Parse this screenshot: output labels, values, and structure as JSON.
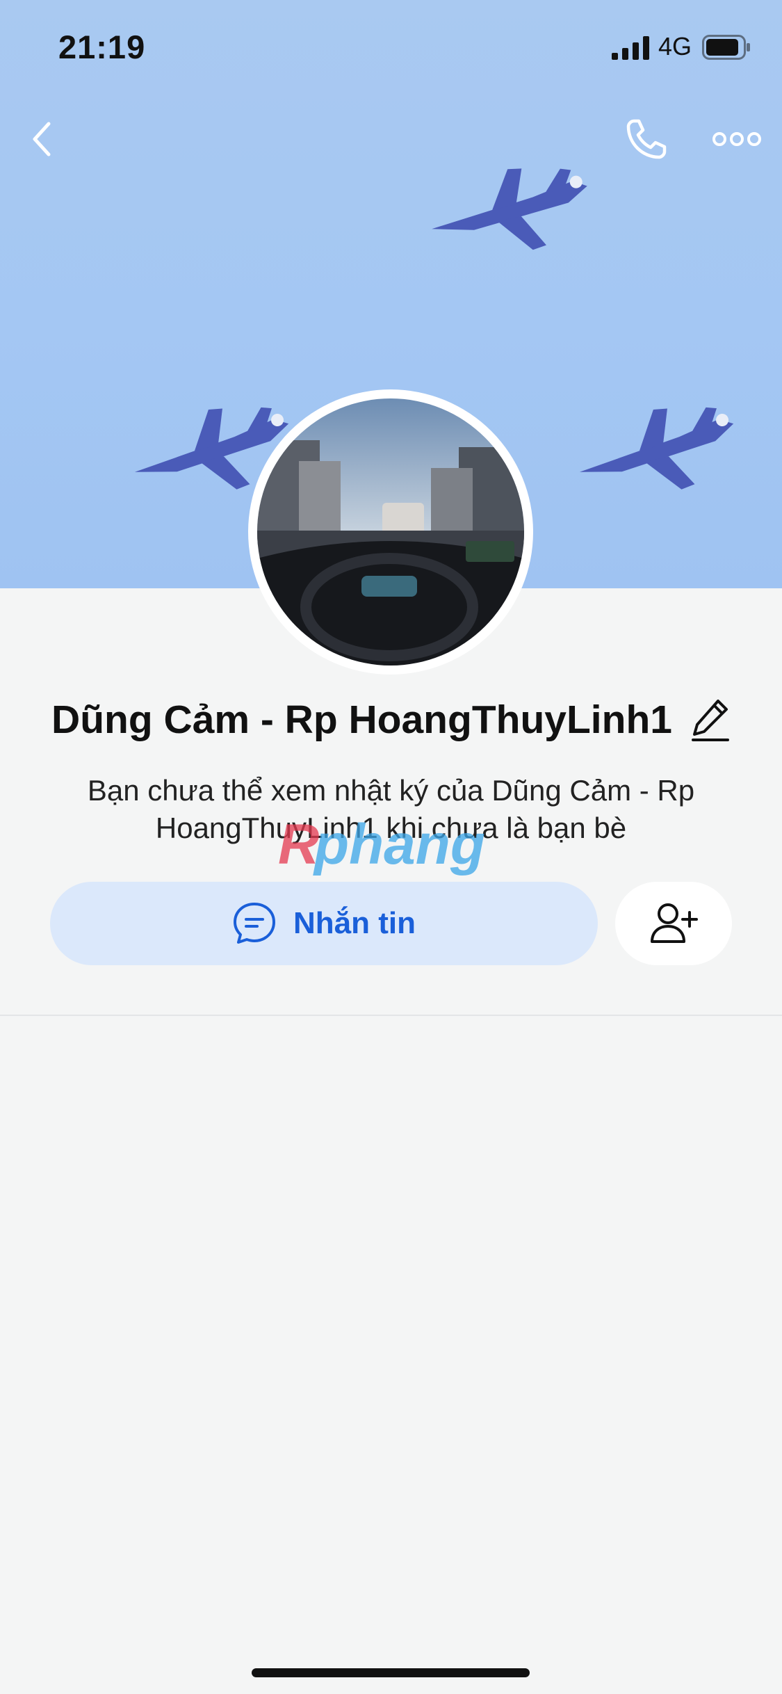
{
  "status_bar": {
    "time": "21:19",
    "network": "4G"
  },
  "header": {
    "back_icon": "chevron-left-icon",
    "call_icon": "phone-icon",
    "more_icon": "more-dots-icon"
  },
  "profile": {
    "name": "Dũng Cảm - Rp HoangThuyLinh1",
    "edit_icon": "pencil-icon",
    "notice": "Bạn chưa thể xem nhật ký của Dũng Cảm - Rp HoangThuyLinh1 khi chưa là bạn bè"
  },
  "actions": {
    "message_label": "Nhắn tin",
    "message_icon": "chat-bubble-icon",
    "add_friend_icon": "add-friend-icon"
  },
  "watermark": {
    "text": "Rphang"
  },
  "colors": {
    "accent": "#1a5fd9",
    "message_button_bg": "#dbe8fb",
    "cover_sky": "#a6c8f3"
  }
}
